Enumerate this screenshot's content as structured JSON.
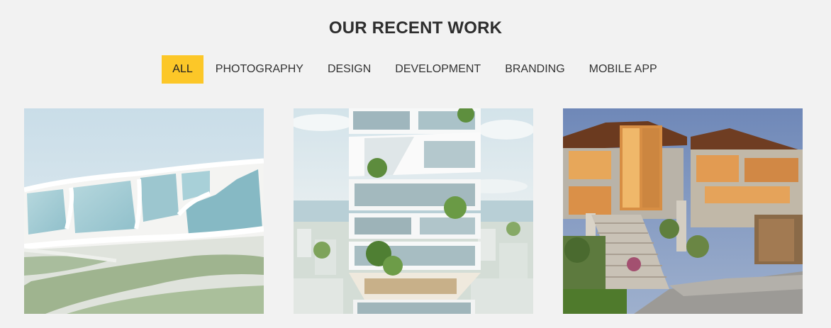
{
  "section": {
    "title": "OUR RECENT WORK"
  },
  "filters": [
    {
      "label": "ALL",
      "active": true
    },
    {
      "label": "PHOTOGRAPHY",
      "active": false
    },
    {
      "label": "DESIGN",
      "active": false
    },
    {
      "label": "DEVELOPMENT",
      "active": false
    },
    {
      "label": "BRANDING",
      "active": false
    },
    {
      "label": "MOBILE APP",
      "active": false
    }
  ],
  "accent_color": "#fcc728",
  "portfolio": [
    {
      "subject": "white curved glass building with lawn"
    },
    {
      "subject": "stacked tower with trees on balconies"
    },
    {
      "subject": "modern house with stairs at dusk"
    }
  ]
}
